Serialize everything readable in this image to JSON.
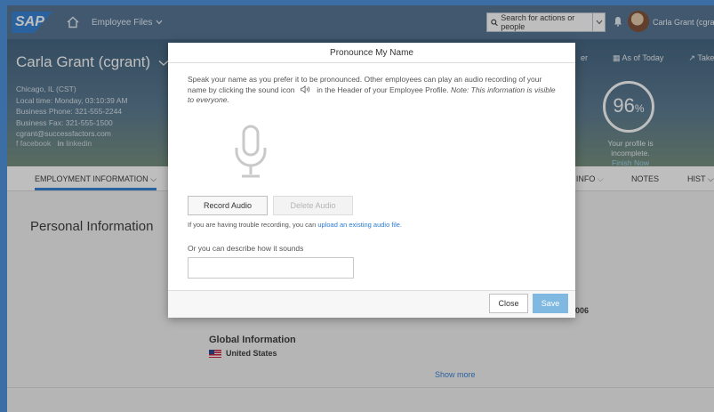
{
  "shell": {
    "logo": "SAP",
    "menu_label": "Employee Files",
    "search_placeholder": "Search for actions or people",
    "user_name": "Carla Grant (cgrant)"
  },
  "profile": {
    "name": "Carla Grant (cgrant)",
    "lines": [
      "Chicago, IL (CST)",
      "Local time: Monday, 03:10:39 AM",
      "Business Phone: 321-555-2244",
      "Business Fax: 321-555-1500",
      "cgrant@successfactors.com"
    ],
    "social": {
      "facebook": "facebook",
      "linkedin": "linkedin"
    },
    "right_links": {
      "partial": "er",
      "as_of_today": "As of Today",
      "take_action": "Take Action"
    },
    "completion": {
      "value": "96",
      "unit": "%"
    },
    "incomplete_text": "Your profile is incomplete.",
    "finish_now": "Finish Now"
  },
  "tabs": {
    "employment": "EMPLOYMENT INFORMATION",
    "info_partial": "T INFO",
    "notes": "NOTES",
    "hist_partial": "HIST"
  },
  "content": {
    "section_title": "Personal Information",
    "year_partial": "2006",
    "global_title": "Global Information",
    "country": "United States",
    "show_more": "Show more"
  },
  "dialog": {
    "title": "Pronounce My Name",
    "desc_main": "Speak your name as you prefer it to be pronounced. Other employees can play an audio recording of your name by clicking the sound icon",
    "desc_after": "in the Header of your Employee Profile.",
    "desc_note": "Note: This information is visible to everyone.",
    "record_label": "Record Audio",
    "delete_label": "Delete Audio",
    "trouble_text": "If you are having trouble recording, you can",
    "upload_link": "upload an existing audio file.",
    "describe_label": "Or you can describe how it sounds",
    "describe_value": "",
    "close_label": "Close",
    "save_label": "Save"
  },
  "colors": {
    "accent": "#2a7bd3",
    "shell": "#4c6e8e",
    "save": "#7fb8e0"
  }
}
